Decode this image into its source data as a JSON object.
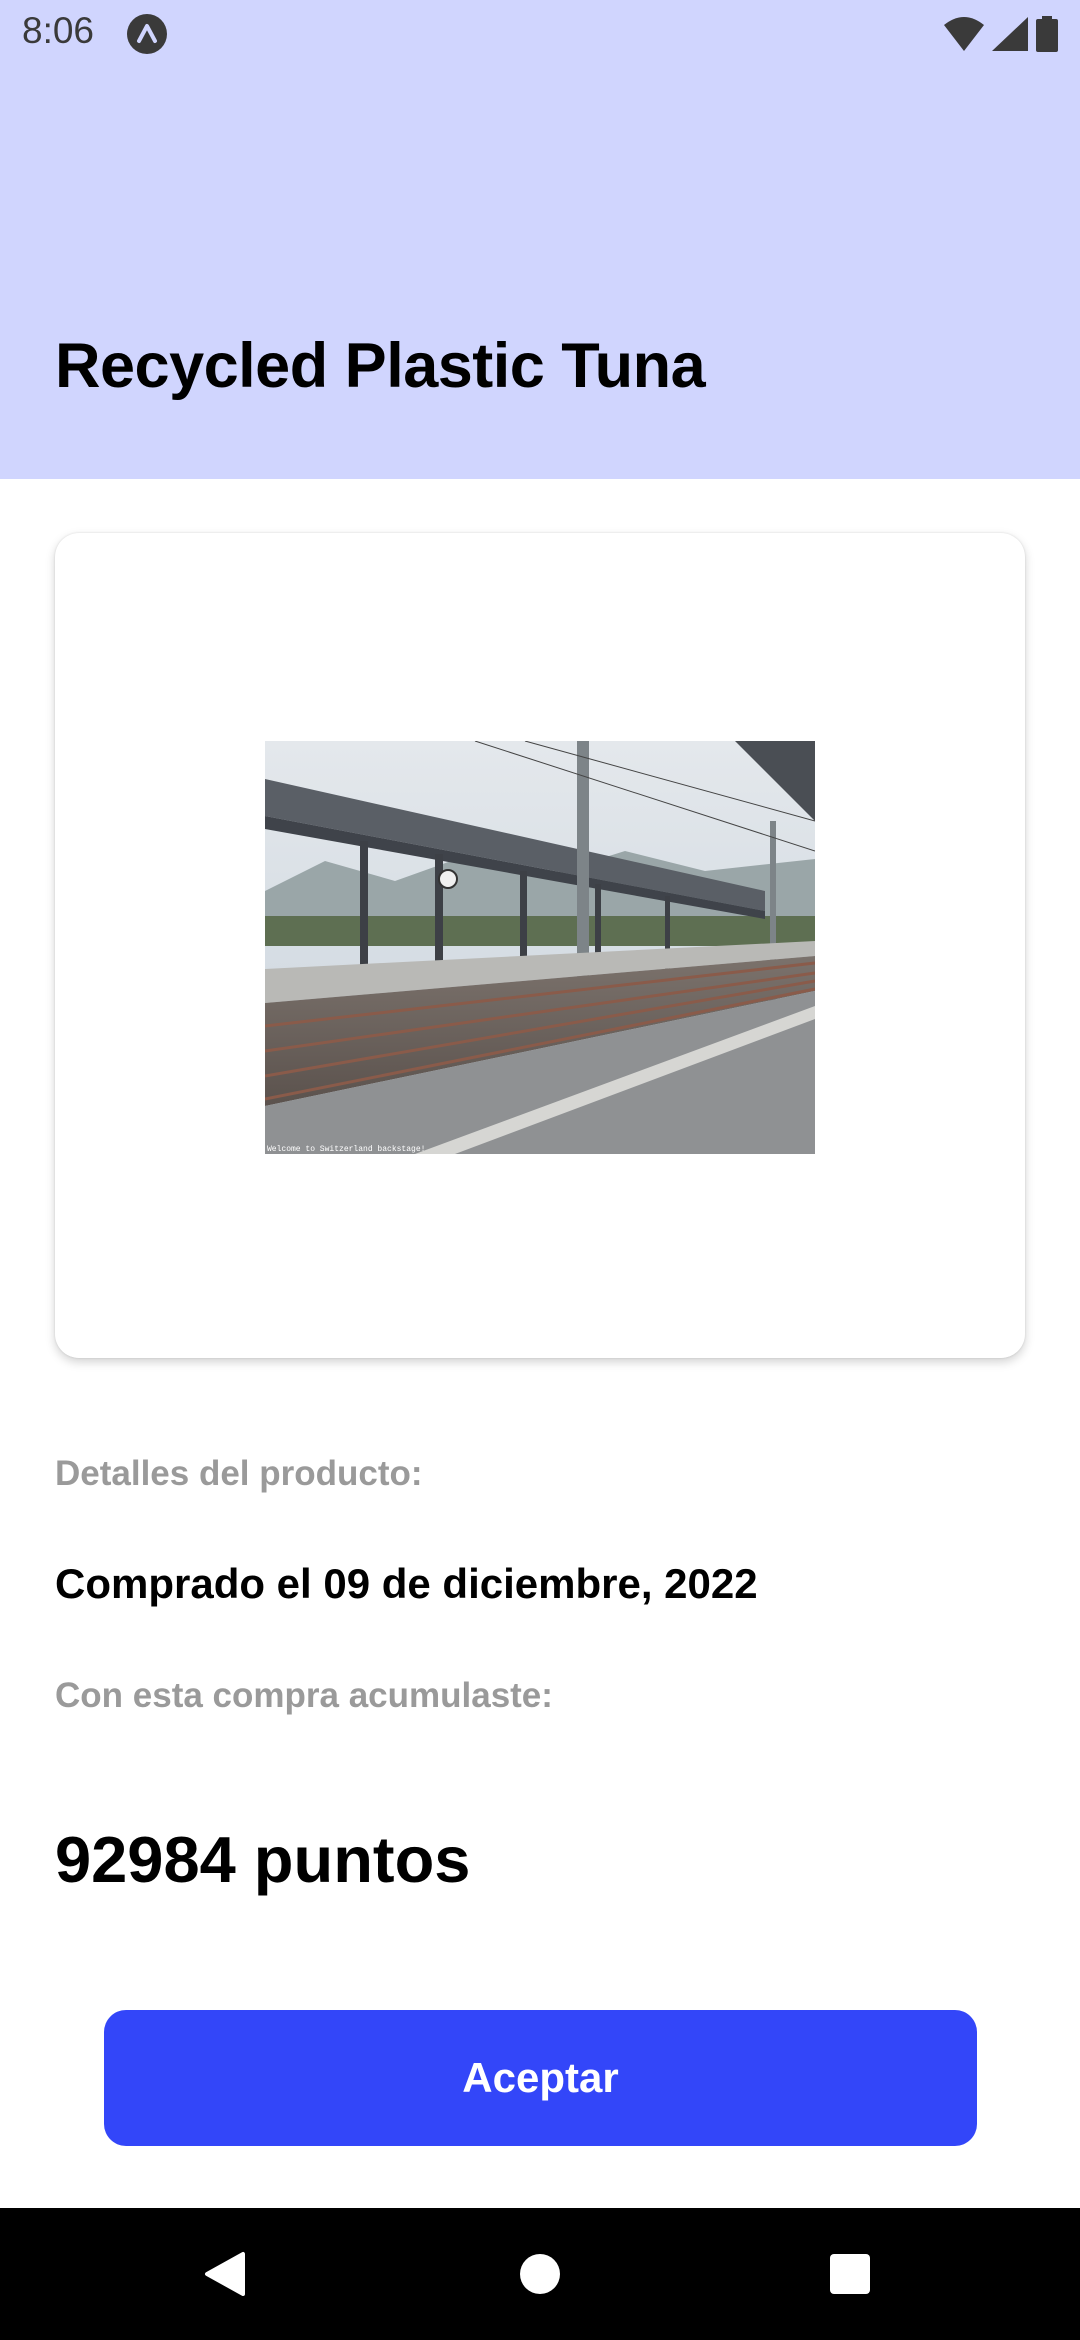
{
  "status_bar": {
    "time": "8:06",
    "icons": [
      "app-notification-icon",
      "wifi-icon",
      "cell-signal-icon",
      "battery-icon"
    ]
  },
  "header": {
    "title": "Recycled Plastic Tuna",
    "background": "#d0d5fe"
  },
  "product": {
    "image_icon": "train-station-photo",
    "image_caption": "Welcome to Switzerland backstage!"
  },
  "details": {
    "section_label": "Detalles del producto:",
    "purchase_date": "Comprado el 09 de diciembre, 2022",
    "earned_label": "Con esta compra acumulaste:",
    "points": "92984 puntos"
  },
  "actions": {
    "accept_label": "Aceptar",
    "accent": "#3346f9"
  },
  "nav_bar": {
    "icons": [
      "back-icon",
      "home-icon",
      "recents-icon"
    ]
  }
}
